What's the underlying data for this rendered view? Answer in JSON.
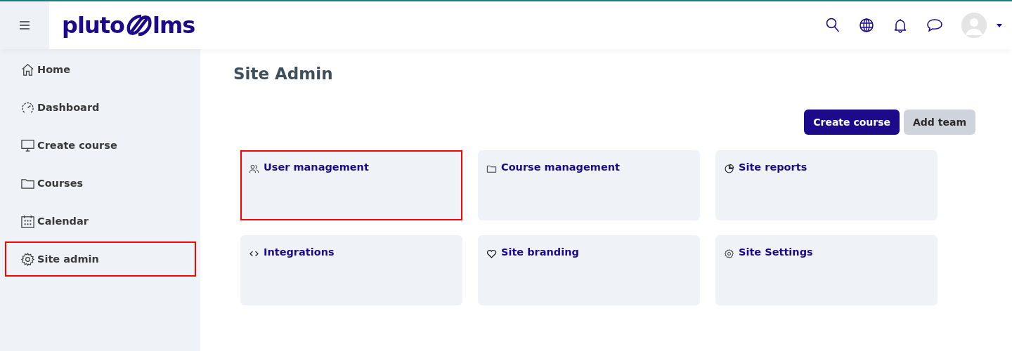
{
  "logo": {
    "left": "pluto",
    "right": "lms"
  },
  "sidebar": {
    "items": [
      {
        "label": "Home",
        "highlighted": false
      },
      {
        "label": "Dashboard",
        "highlighted": false
      },
      {
        "label": "Create course",
        "highlighted": false
      },
      {
        "label": "Courses",
        "highlighted": false
      },
      {
        "label": "Calendar",
        "highlighted": false
      },
      {
        "label": "Site admin",
        "highlighted": true
      }
    ]
  },
  "page": {
    "title": "Site Admin"
  },
  "buttons": [
    {
      "label": "Create course",
      "kind": "primary"
    },
    {
      "label": "Add team",
      "kind": "secondary"
    }
  ],
  "cards": [
    {
      "title": "User management",
      "highlighted": true
    },
    {
      "title": "Course management",
      "highlighted": false
    },
    {
      "title": "Site reports",
      "highlighted": false
    },
    {
      "title": "Integrations",
      "highlighted": false
    },
    {
      "title": "Site branding",
      "highlighted": false
    },
    {
      "title": "Site Settings",
      "highlighted": false
    }
  ]
}
